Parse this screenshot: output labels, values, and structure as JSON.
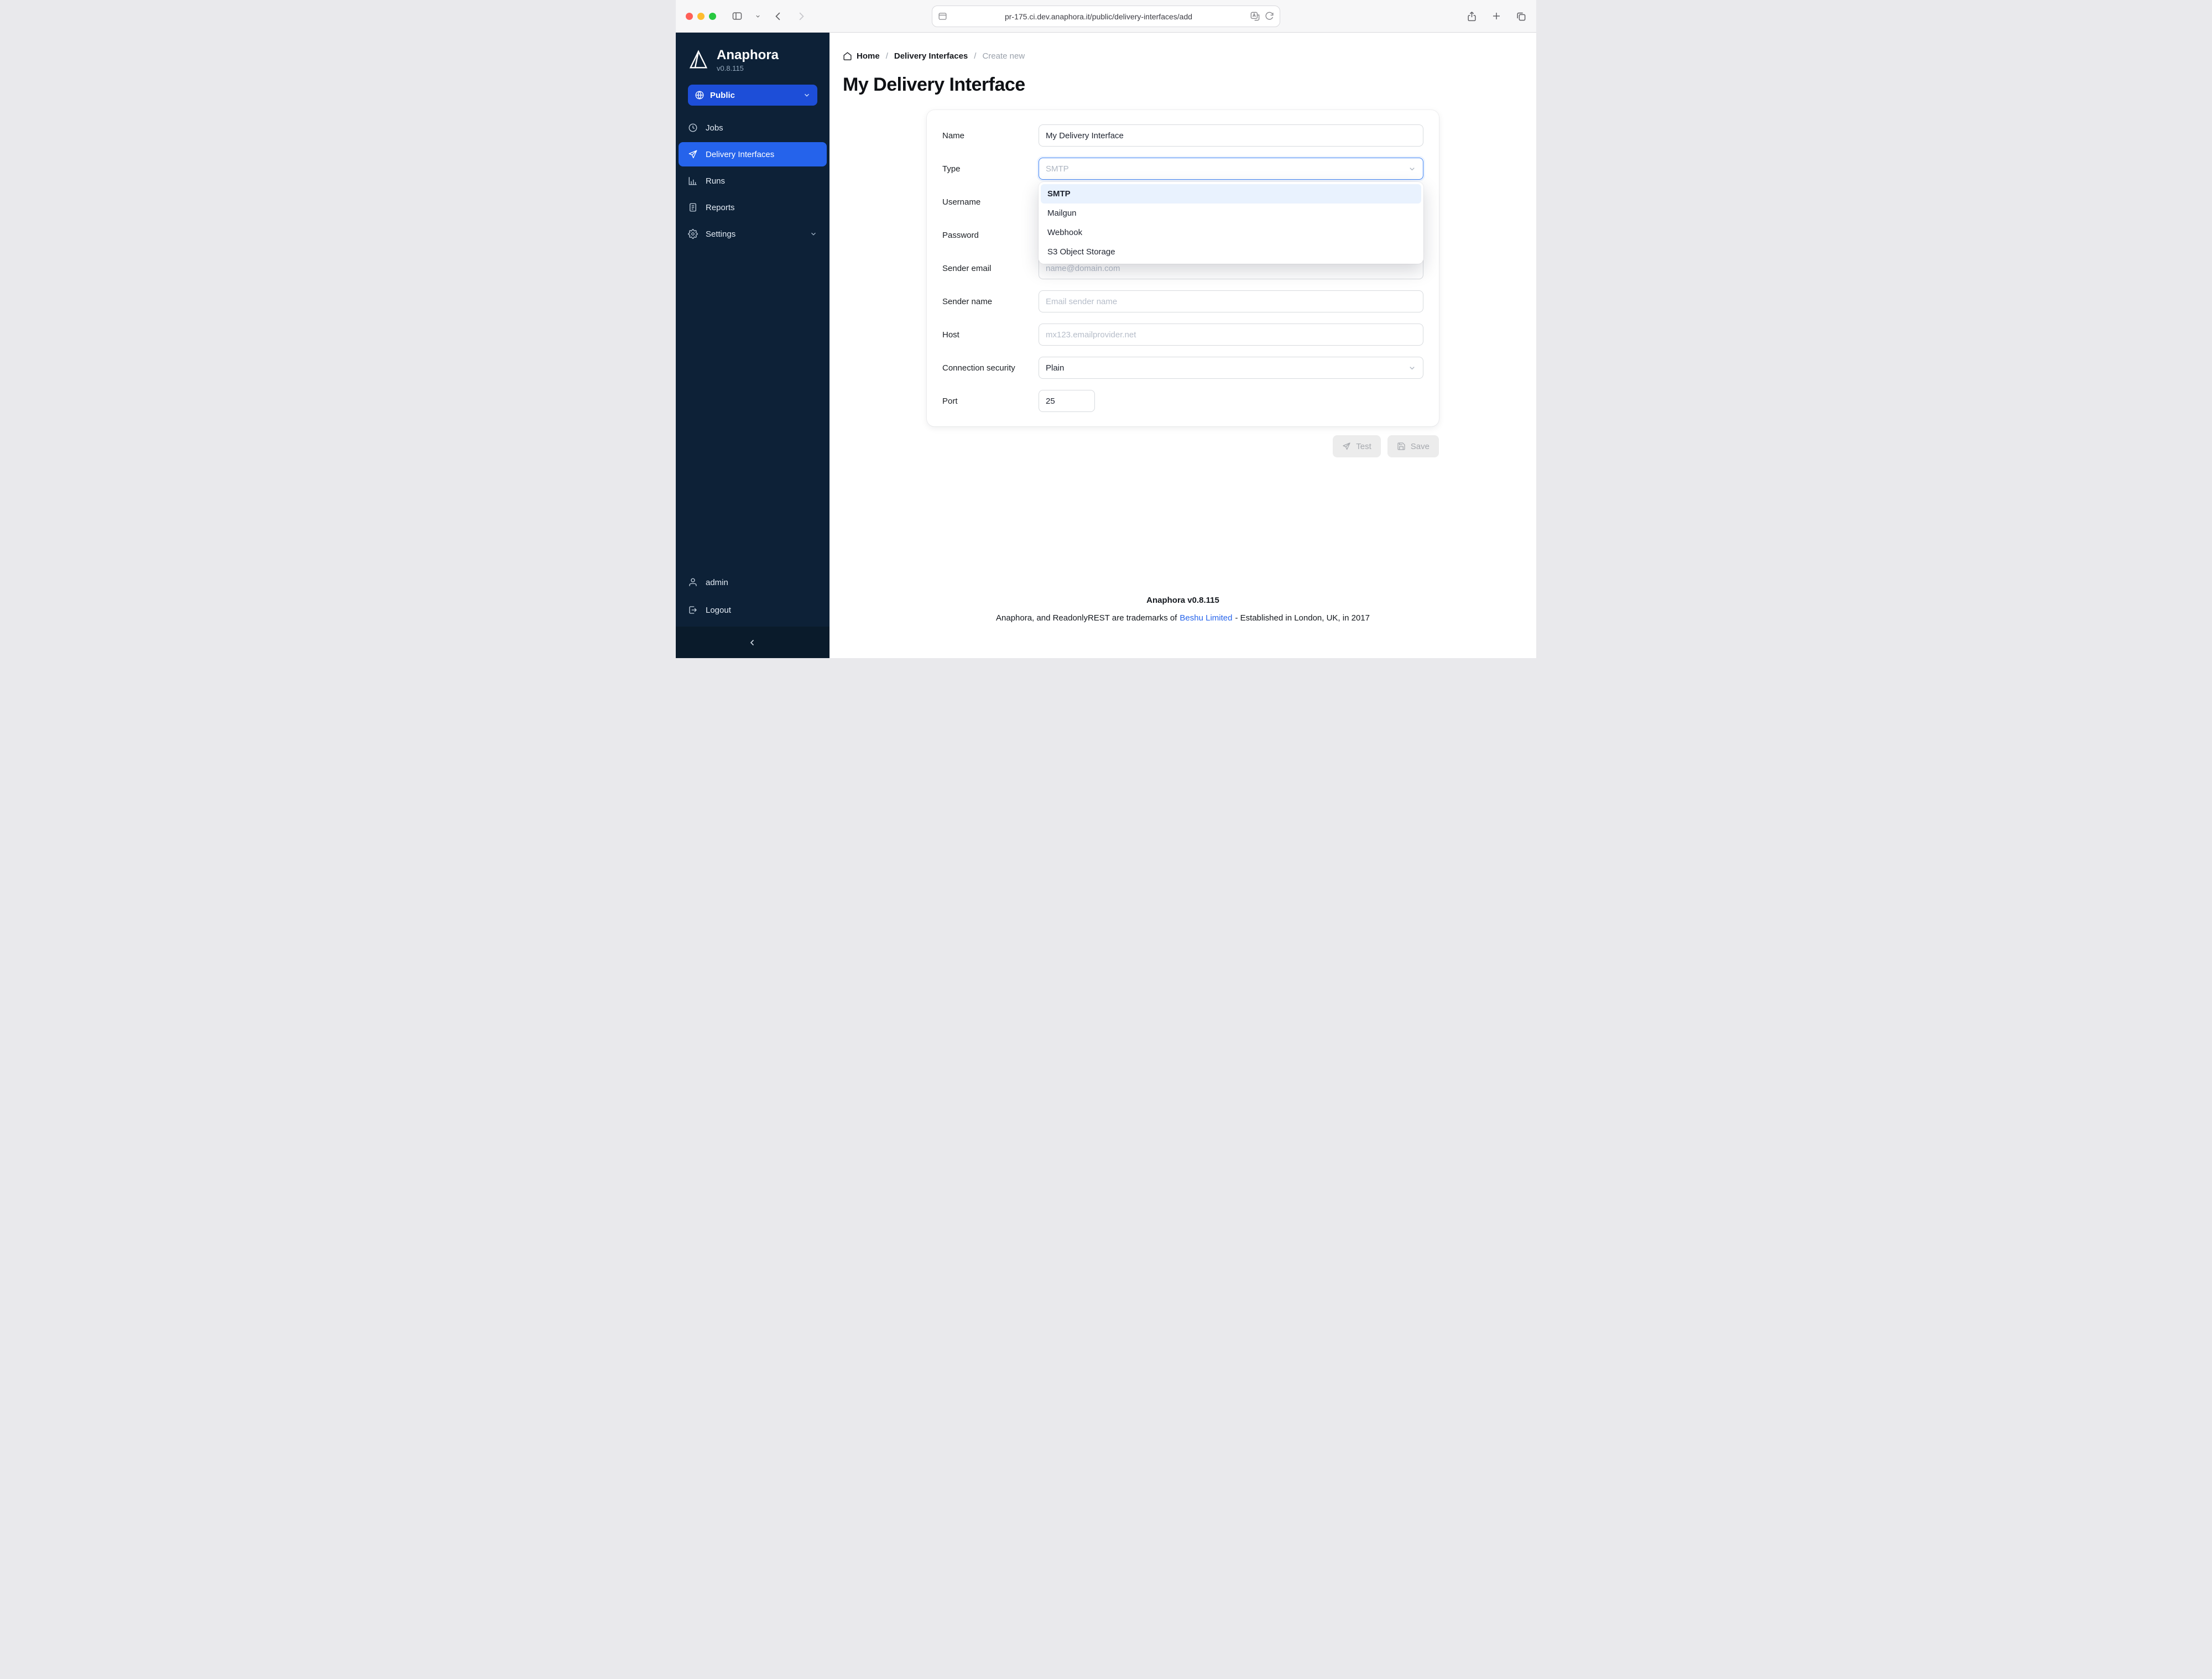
{
  "colors": {
    "sidebar_bg": "#0d2137",
    "sidebar_bottom_bg": "#0a1b2b",
    "accent_blue": "#2563eb",
    "tenant_blue": "#1d4ed8",
    "select_focus_border": "#4285f4",
    "option_highlight": "#e9f2fe",
    "link": "#2563eb",
    "traffic_red": "#ff5f57",
    "traffic_yellow": "#febc2e",
    "traffic_green": "#28c840"
  },
  "icons": {
    "sidebar-toggle-icon": "panel-left",
    "back-icon": "chevron-left",
    "forward-icon": "chevron-right",
    "page-icon": "browser-page",
    "translate-icon": "boxed-A",
    "reload-icon": "circular-arrow",
    "share-icon": "square-arrow-up",
    "new-tab-icon": "plus",
    "tabs-icon": "two-squares",
    "logo-icon": "triangle-prism",
    "globe-icon": "globe",
    "jobs-icon": "clock",
    "delivery-icon": "paper-plane",
    "runs-icon": "bar-chart",
    "reports-icon": "document",
    "settings-icon": "gear",
    "user-icon": "person",
    "logout-icon": "exit-arrow",
    "collapse-icon": "chevron-left",
    "home-icon": "house",
    "test-icon": "paper-plane",
    "save-icon": "floppy-disk"
  },
  "browser": {
    "url": "pr-175.ci.dev.anaphora.it/public/delivery-interfaces/add"
  },
  "sidebar": {
    "brand": {
      "name": "Anaphora",
      "version": "v0.8.115"
    },
    "tenant": {
      "label": "Public"
    },
    "items": [
      {
        "label": "Jobs"
      },
      {
        "label": "Delivery Interfaces"
      },
      {
        "label": "Runs"
      },
      {
        "label": "Reports"
      },
      {
        "label": "Settings"
      }
    ],
    "account": [
      {
        "label": "admin"
      },
      {
        "label": "Logout"
      }
    ]
  },
  "breadcrumb": {
    "items": [
      "Home",
      "Delivery Interfaces",
      "Create new"
    ]
  },
  "page": {
    "title": "My Delivery Interface"
  },
  "form": {
    "fields": {
      "name": {
        "label": "Name",
        "value": "My Delivery Interface"
      },
      "type": {
        "label": "Type",
        "value": "SMTP",
        "selected": "SMTP",
        "options": [
          "SMTP",
          "Mailgun",
          "Webhook",
          "S3 Object Storage"
        ]
      },
      "username": {
        "label": "Username"
      },
      "password": {
        "label": "Password"
      },
      "sender_email": {
        "label": "Sender email",
        "placeholder": "name@domain.com"
      },
      "sender_name": {
        "label": "Sender name",
        "placeholder": "Email sender name"
      },
      "host": {
        "label": "Host",
        "placeholder": "mx123.emailprovider.net"
      },
      "connection_security": {
        "label": "Connection security",
        "value": "Plain"
      },
      "port": {
        "label": "Port",
        "value": "25"
      }
    },
    "actions": {
      "test_label": "Test",
      "save_label": "Save"
    }
  },
  "footer": {
    "version_line": "Anaphora v0.8.115",
    "trademark_prefix": "Anaphora, and ReadonlyREST are trademarks of",
    "trademark_link": "Beshu Limited",
    "trademark_suffix": "- Established in London, UK, in 2017"
  }
}
